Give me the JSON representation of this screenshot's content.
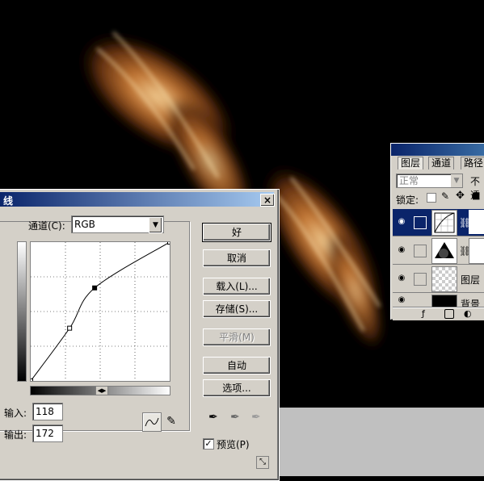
{
  "layers_panel": {
    "tabs": [
      "图层",
      "通道",
      "路径"
    ],
    "blend_mode": "正常",
    "opacity_label": "不透",
    "lock_label": "锁定:",
    "layers": [
      {
        "name": "",
        "type": "adjustment-curves",
        "selected": true
      },
      {
        "name": "",
        "type": "mask",
        "selected": false
      },
      {
        "name": "图层",
        "type": "transparent",
        "selected": false
      },
      {
        "name": "背景",
        "type": "background",
        "selected": false
      }
    ]
  },
  "curves_dialog": {
    "title": "线",
    "channel_label": "通道(C):",
    "channel_value": "RGB",
    "input_label": "输入:",
    "input_value": "118",
    "output_label": "输出:",
    "output_value": "172",
    "buttons": {
      "ok": "好",
      "cancel": "取消",
      "load": "载入(L)...",
      "save": "存储(S)...",
      "smooth": "平滑(M)",
      "auto": "自动",
      "options": "选项..."
    },
    "preview_label": "预览(P)",
    "preview_checked": true,
    "curve_points": [
      [
        0,
        0
      ],
      [
        0.28,
        0.38
      ],
      [
        0.46,
        0.67
      ],
      [
        1,
        1
      ]
    ]
  }
}
